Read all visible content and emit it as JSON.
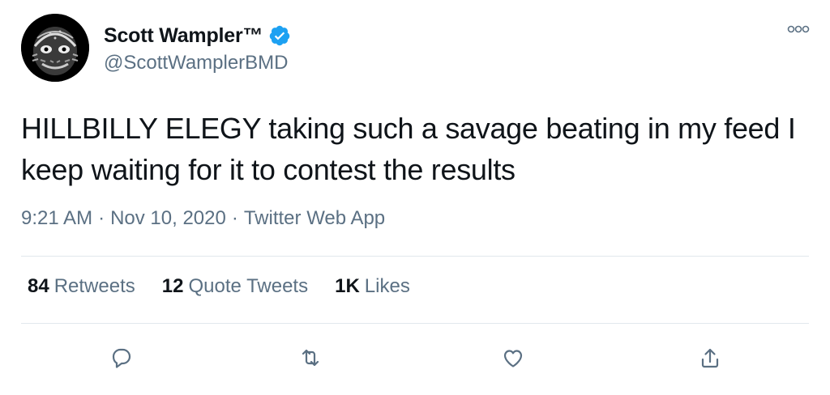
{
  "user": {
    "display_name": "Scott Wampler™",
    "handle": "@ScottWamplerBMD",
    "verified": true
  },
  "tweet": {
    "text": "HILLBILLY ELEGY taking such a savage beating in my feed I keep waiting for it to contest the results",
    "time": "9:21 AM",
    "date": "Nov 10, 2020",
    "source": "Twitter Web App",
    "separator": "·"
  },
  "stats": {
    "retweets_count": "84",
    "retweets_label": "Retweets",
    "quote_count": "12",
    "quote_label": "Quote Tweets",
    "likes_count": "1K",
    "likes_label": "Likes"
  },
  "icons": {
    "avatar": "creature-avatar",
    "verified": "verified-badge-icon",
    "more": "more-icon",
    "reply": "reply-icon",
    "retweet": "retweet-icon",
    "like": "heart-icon",
    "share": "share-icon"
  },
  "colors": {
    "text": "#0f1419",
    "secondary": "#5b7083",
    "accent": "#1da1f2",
    "divider": "#e1e8ed"
  }
}
